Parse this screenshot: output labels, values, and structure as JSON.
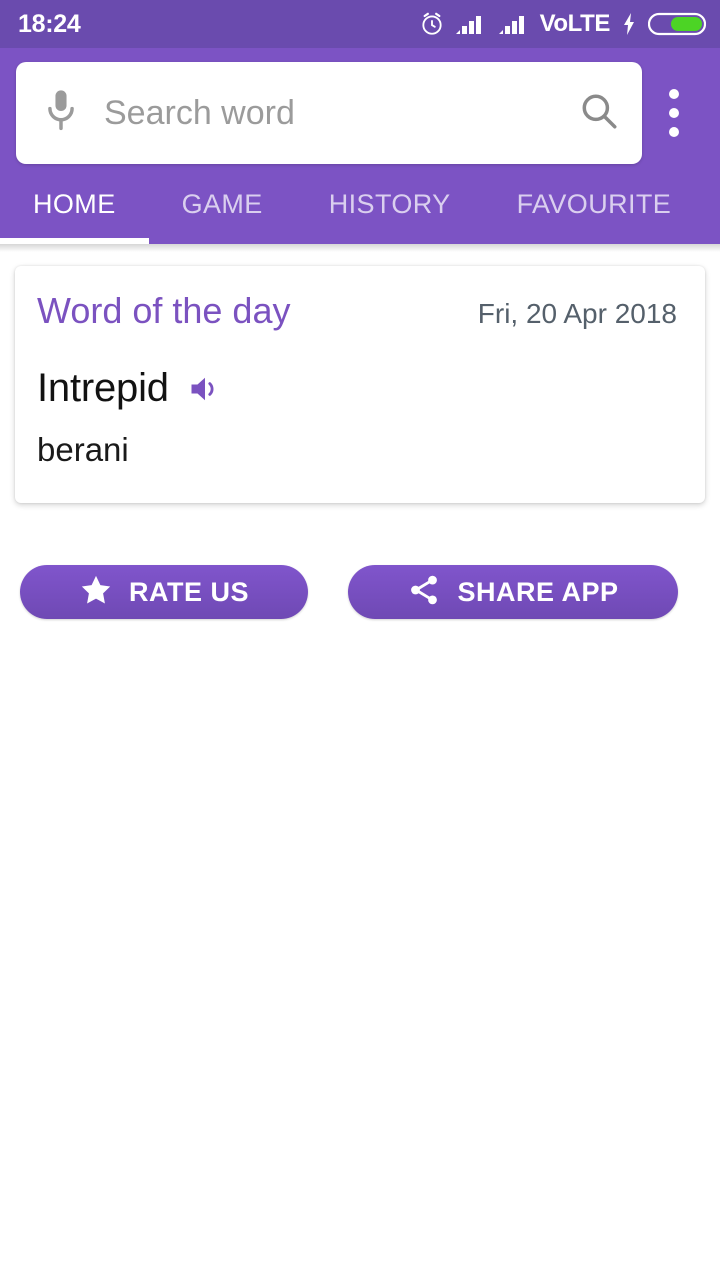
{
  "status_bar": {
    "time": "18:24",
    "alarm_icon": "alarm-clock-icon",
    "signal_1_icon": "signal-bars-icon",
    "signal_2_icon": "signal-bars-icon",
    "network_label": "VoLTE",
    "charging_icon": "charging-bolt-icon",
    "battery_icon": "battery-icon",
    "battery_level_percent": 62,
    "background_color": "#6A4BAE",
    "battery_fill_color": "#4CD425"
  },
  "app_bar": {
    "background_color": "#7C53C4",
    "search": {
      "mic_icon": "microphone-icon",
      "placeholder": "Search word",
      "value": "",
      "search_icon": "search-icon"
    },
    "overflow_menu_icon": "more-vertical-icon"
  },
  "tabs": {
    "active_index": 0,
    "items": [
      {
        "label": "HOME"
      },
      {
        "label": "GAME"
      },
      {
        "label": "HISTORY"
      },
      {
        "label": "FAVOURITE"
      }
    ]
  },
  "word_of_the_day": {
    "title": "Word of the day",
    "title_color": "#7B52C0",
    "date": "Fri, 20 Apr 2018",
    "word": "Intrepid",
    "speaker_icon": "speaker-volume-icon",
    "translation": "berani"
  },
  "actions": {
    "rate": {
      "label": "RATE US",
      "icon": "star-icon"
    },
    "share": {
      "label": "SHARE APP",
      "icon": "share-nodes-icon"
    },
    "button_color": "#7C53C4"
  }
}
